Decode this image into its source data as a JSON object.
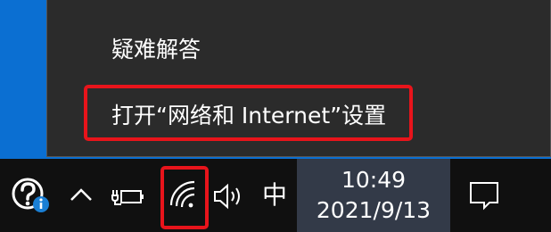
{
  "menu": {
    "items": [
      {
        "label": "疑难解答"
      },
      {
        "label": "打开“网络和 Internet”设置"
      }
    ]
  },
  "taskbar": {
    "ime_label": "中",
    "clock_time": "10:49",
    "clock_date": "2021/9/13",
    "icons": [
      "help-icon",
      "chevron-up-icon",
      "battery-icon",
      "wifi-icon",
      "volume-icon",
      "notification-icon"
    ]
  },
  "colors": {
    "desktop": "#0b6fd2",
    "menu_bg": "#2b2b2b",
    "taskbar_bg": "#101010",
    "highlight": "#e8141b",
    "clock_bg": "#333a48"
  }
}
